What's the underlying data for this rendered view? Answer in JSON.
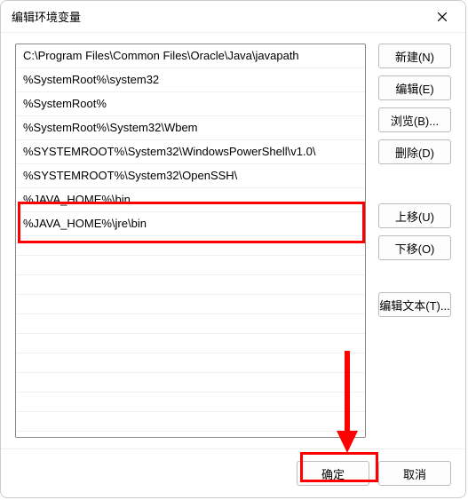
{
  "dialog": {
    "title": "编辑环境变量"
  },
  "list": {
    "items": [
      "C:\\Program Files\\Common Files\\Oracle\\Java\\javapath",
      "%SystemRoot%\\system32",
      "%SystemRoot%",
      "%SystemRoot%\\System32\\Wbem",
      "%SYSTEMROOT%\\System32\\WindowsPowerShell\\v1.0\\",
      "%SYSTEMROOT%\\System32\\OpenSSH\\",
      "%JAVA_HOME%\\bin",
      "%JAVA_HOME%\\jre\\bin"
    ]
  },
  "buttons": {
    "new": "新建(N)",
    "edit": "编辑(E)",
    "browse": "浏览(B)...",
    "delete": "删除(D)",
    "moveUp": "上移(U)",
    "moveDown": "下移(O)",
    "editText": "编辑文本(T)...",
    "ok": "确定",
    "cancel": "取消"
  }
}
